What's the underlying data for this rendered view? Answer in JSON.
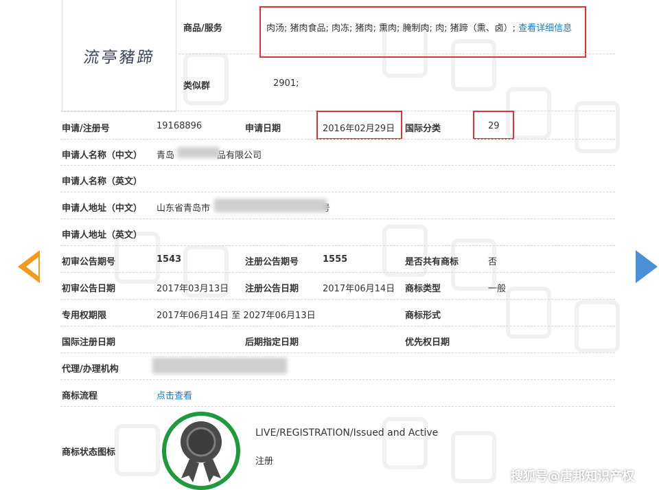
{
  "logo": {
    "text": "流亭豬蹄"
  },
  "goods_services": {
    "label": "商品/服务",
    "value": "肉汤; 猪肉食品; 肉冻; 猪肉; 熏肉; 腌制肉; 肉; 猪蹄（熏、卤）;",
    "link": "查看详细信息"
  },
  "similar_group": {
    "label": "类似群",
    "value": "2901;"
  },
  "reg_number": {
    "label": "申请/注册号",
    "value": "19168896"
  },
  "application_date": {
    "label": "申请日期",
    "value": "2016年02月29日"
  },
  "intl_class": {
    "label": "国际分类",
    "value": "29"
  },
  "applicant_cn": {
    "label": "申请人名称（中文）",
    "value_prefix": "青岛",
    "value_suffix": "品有限公司"
  },
  "applicant_en": {
    "label": "申请人名称（英文）"
  },
  "address_cn": {
    "label": "申请人地址（中文）",
    "value_prefix": "山东省青岛市",
    "value_suffix": "号"
  },
  "address_en": {
    "label": "申请人地址（英文）"
  },
  "prelim_pub_no": {
    "label": "初审公告期号",
    "value": "1543"
  },
  "reg_pub_no": {
    "label": "注册公告期号",
    "value": "1555"
  },
  "shared_mark": {
    "label": "是否共有商标",
    "value": "否"
  },
  "prelim_pub_date": {
    "label": "初审公告日期",
    "value": "2017年03月13日"
  },
  "reg_pub_date": {
    "label": "注册公告日期",
    "value": "2017年06月14日"
  },
  "mark_type": {
    "label": "商标类型",
    "value": "一般"
  },
  "exclusive_period": {
    "label": "专用权期限",
    "value": "2017年06月14日 至 2027年06月13日"
  },
  "mark_form": {
    "label": "商标形式"
  },
  "intl_reg_date": {
    "label": "国际注册日期"
  },
  "later_designation_date": {
    "label": "后期指定日期"
  },
  "priority_date": {
    "label": "优先权日期"
  },
  "agent": {
    "label": "代理/办理机构"
  },
  "process": {
    "label": "商标流程",
    "link": "点击查看"
  },
  "status_icon": {
    "label": "商标状态图标",
    "status_en": "LIVE/REGISTRATION/Issued and Active",
    "status_cn": "注册",
    "ring_color": "#1e9a3a"
  },
  "footer": {
    "brand": "搜狐号@唐邦知识产权"
  },
  "colors": {
    "highlight": "#e23131",
    "link": "#1a7ac5",
    "prev_arrow": "#f39a1c",
    "next_arrow": "#4a90d9"
  }
}
